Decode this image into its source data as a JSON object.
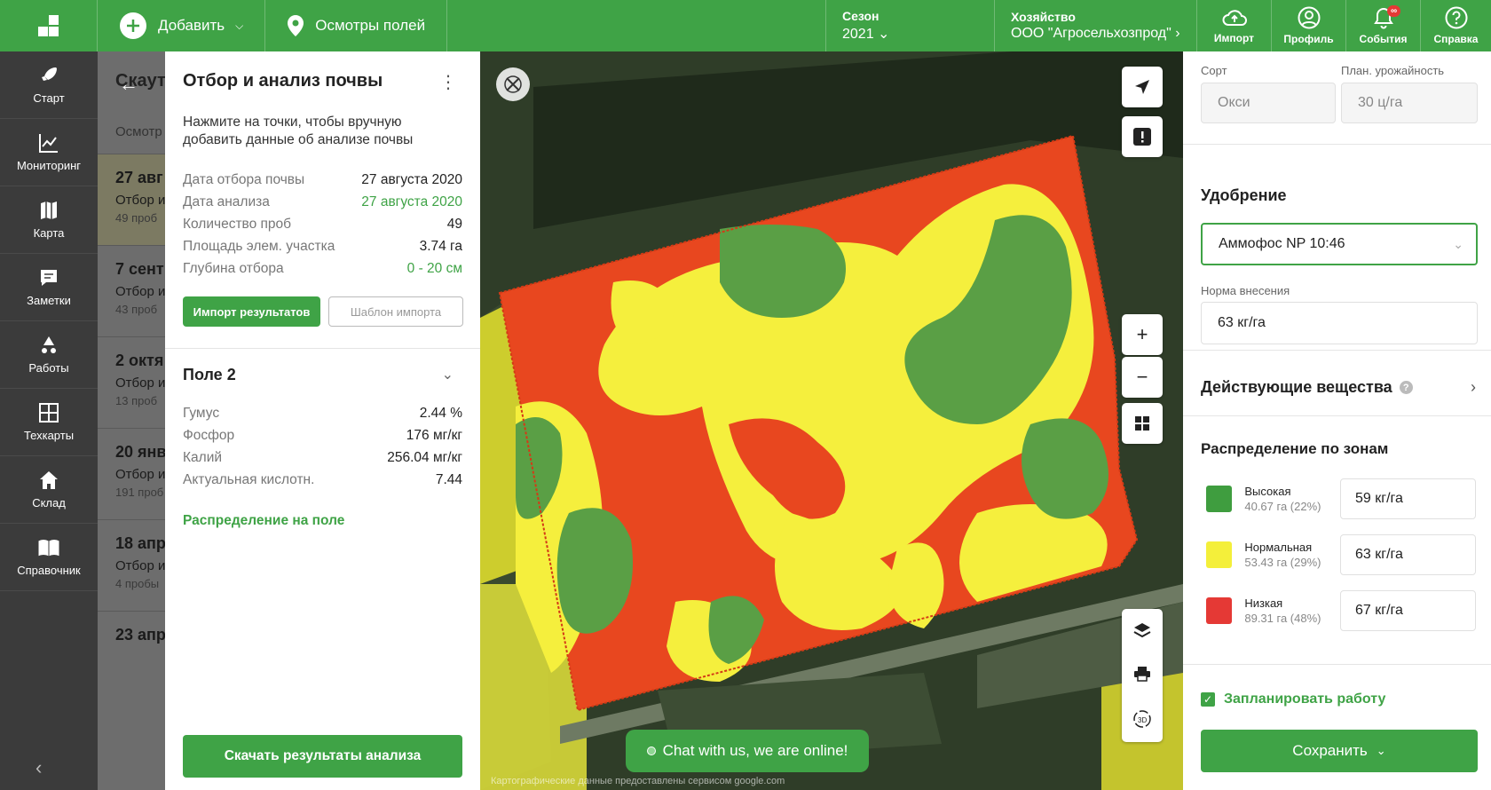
{
  "topbar": {
    "add_label": "Добавить",
    "inspections_label": "Осмотры полей",
    "season_label": "Сезон",
    "season_value": "2021",
    "farm_label": "Хозяйство",
    "farm_value": "ООО \"Агросельхозпрод\"",
    "import_label": "Импорт",
    "profile_label": "Профиль",
    "events_label": "События",
    "events_badge": "∞",
    "help_label": "Справка"
  },
  "nav": {
    "items": [
      {
        "label": "Старт",
        "icon": "rocket-icon"
      },
      {
        "label": "Мониторинг",
        "icon": "chart-line-icon"
      },
      {
        "label": "Карта",
        "icon": "map-icon"
      },
      {
        "label": "Заметки",
        "icon": "note-icon"
      },
      {
        "label": "Работы",
        "icon": "tractor-icon"
      },
      {
        "label": "Техкарты",
        "icon": "grid-icon"
      },
      {
        "label": "Склад",
        "icon": "home-icon"
      },
      {
        "label": "Справочник",
        "icon": "book-icon"
      }
    ]
  },
  "bglist": {
    "header": "Скаут",
    "subheader": "Осмотр",
    "rows": [
      {
        "date": "27 авг",
        "type": "Отбор и",
        "count": "49 проб"
      },
      {
        "date": "7 сент",
        "type": "Отбор и",
        "count": "43 проб"
      },
      {
        "date": "2 октя",
        "type": "Отбор и",
        "count": "13 проб"
      },
      {
        "date": "20 янв",
        "type": "Отбор и",
        "count": "191 проб"
      },
      {
        "date": "18 апр",
        "type": "Отбор и",
        "count": "4 пробы"
      },
      {
        "date": "23 апр",
        "type": "",
        "count": ""
      }
    ]
  },
  "soil": {
    "title": "Отбор и анализ почвы",
    "hint": "Нажмите на точки, чтобы вручную добавить данные об анализе почвы",
    "fields": [
      {
        "key": "Дата отбора почвы",
        "value": "27 августа 2020",
        "green": false
      },
      {
        "key": "Дата анализа",
        "value": "27 августа 2020",
        "green": true
      },
      {
        "key": "Количество проб",
        "value": "49",
        "green": false
      },
      {
        "key": "Площадь элем. участка",
        "value": "3.74 га",
        "green": false
      },
      {
        "key": "Глубина отбора",
        "value": "0 - 20 см",
        "green": true
      }
    ],
    "import_button": "Импорт результатов",
    "template_button": "Шаблон импорта",
    "field_title": "Поле 2",
    "metrics": [
      {
        "key": "Гумус",
        "value": "2.44 %"
      },
      {
        "key": "Фосфор",
        "value": "176 мг/кг"
      },
      {
        "key": "Калий",
        "value": "256.04 мг/кг"
      },
      {
        "key": "Актуальная кислотн.",
        "value": "7.44"
      }
    ],
    "distribution_link": "Распределение на поле",
    "download_button": "Скачать результаты анализа"
  },
  "map": {
    "chat_label": "Chat with us, we are online!",
    "credits": "Картографические данные предоставлены сервисом google.com"
  },
  "right": {
    "variety_label": "Сорт",
    "variety_value": "Окси",
    "yield_label": "План. урожайность",
    "yield_value": "30 ц/га",
    "fertilizer_title": "Удобрение",
    "fertilizer_value": "Аммофос NP 10:46",
    "rate_label": "Норма внесения",
    "rate_value": "63 кг/га",
    "substances_title": "Действующие вещества",
    "zones_title": "Распределение по зонам",
    "zones": [
      {
        "name": "Высокая",
        "area": "40.67 га (22%)",
        "rate": "59 кг/га",
        "color": "#3f9d3f"
      },
      {
        "name": "Нормальная",
        "area": "53.43 га (29%)",
        "rate": "63 кг/га",
        "color": "#f4ef3a"
      },
      {
        "name": "Низкая",
        "area": "89.31 га (48%)",
        "rate": "67 кг/га",
        "color": "#e53935"
      }
    ],
    "plan_label": "Запланировать работу",
    "save_label": "Сохранить"
  }
}
